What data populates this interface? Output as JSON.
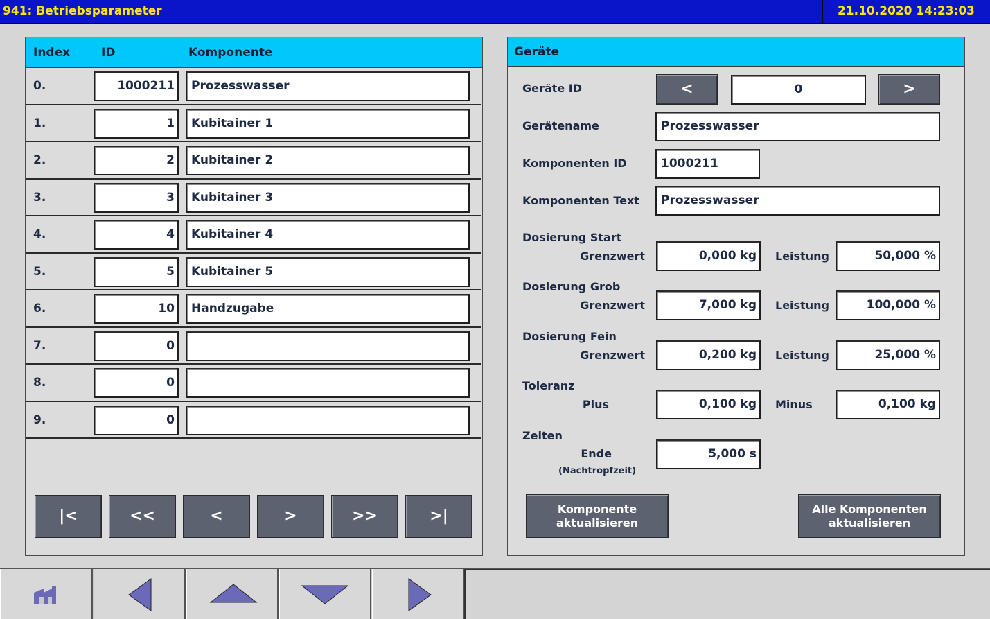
{
  "titlebar": {
    "title": "941: Betriebsparameter",
    "datetime": "21.10.2020 14:23:03"
  },
  "list": {
    "headers": {
      "index": "Index",
      "id": "ID",
      "component": "Komponente"
    },
    "rows": [
      {
        "index": "0.",
        "id": "1000211",
        "name": "Prozesswasser"
      },
      {
        "index": "1.",
        "id": "1",
        "name": "Kubitainer 1"
      },
      {
        "index": "2.",
        "id": "2",
        "name": "Kubitainer 2"
      },
      {
        "index": "3.",
        "id": "3",
        "name": "Kubitainer 3"
      },
      {
        "index": "4.",
        "id": "4",
        "name": "Kubitainer 4"
      },
      {
        "index": "5.",
        "id": "5",
        "name": "Kubitainer 5"
      },
      {
        "index": "6.",
        "id": "10",
        "name": "Handzugabe"
      },
      {
        "index": "7.",
        "id": "0",
        "name": ""
      },
      {
        "index": "8.",
        "id": "0",
        "name": ""
      },
      {
        "index": "9.",
        "id": "0",
        "name": ""
      }
    ],
    "nav": {
      "first": "|<",
      "prev_page": "<<",
      "prev": "<",
      "next": ">",
      "next_page": ">>",
      "last": ">|"
    }
  },
  "device": {
    "header": "Geräte",
    "device_id_label": "Geräte ID",
    "device_id_value": "0",
    "prev_label": "<",
    "next_label": ">",
    "device_name_label": "Gerätename",
    "device_name_value": "Prozesswasser",
    "component_id_label": "Komponenten ID",
    "component_id_value": "1000211",
    "component_text_label": "Komponenten Text",
    "component_text_value": "Prozesswasser",
    "dosing_start": {
      "label": "Dosierung Start",
      "limit_label": "Grenzwert",
      "limit_value": "0,000 kg",
      "power_label": "Leistung",
      "power_value": "50,000 %"
    },
    "dosing_coarse": {
      "label": "Dosierung Grob",
      "limit_label": "Grenzwert",
      "limit_value": "7,000 kg",
      "power_label": "Leistung",
      "power_value": "100,000 %"
    },
    "dosing_fine": {
      "label": "Dosierung Fein",
      "limit_label": "Grenzwert",
      "limit_value": "0,200 kg",
      "power_label": "Leistung",
      "power_value": "25,000 %"
    },
    "tolerance": {
      "label": "Toleranz",
      "plus_label": "Plus",
      "plus_value": "0,100 kg",
      "minus_label": "Minus",
      "minus_value": "0,100 kg"
    },
    "times": {
      "label": "Zeiten",
      "end_label": "Ende",
      "end_sub_label": "(Nachtropfzeit)",
      "end_value": "5,000 s"
    },
    "update_component_line1": "Komponente",
    "update_component_line2": "aktualisieren",
    "update_all_line1": "Alle Komponenten",
    "update_all_line2": "aktualisieren"
  },
  "bottombar": {
    "icons": [
      "home-icon",
      "arrow-left-icon",
      "arrow-up-icon",
      "arrow-down-icon",
      "arrow-right-icon"
    ]
  },
  "colors": {
    "titlebar_bg": "#0a14c8",
    "title_text": "#ffe600",
    "header_bg": "#00c8f8",
    "button_bg": "#5c6270",
    "nav_arrow": "#6a6ab8"
  }
}
